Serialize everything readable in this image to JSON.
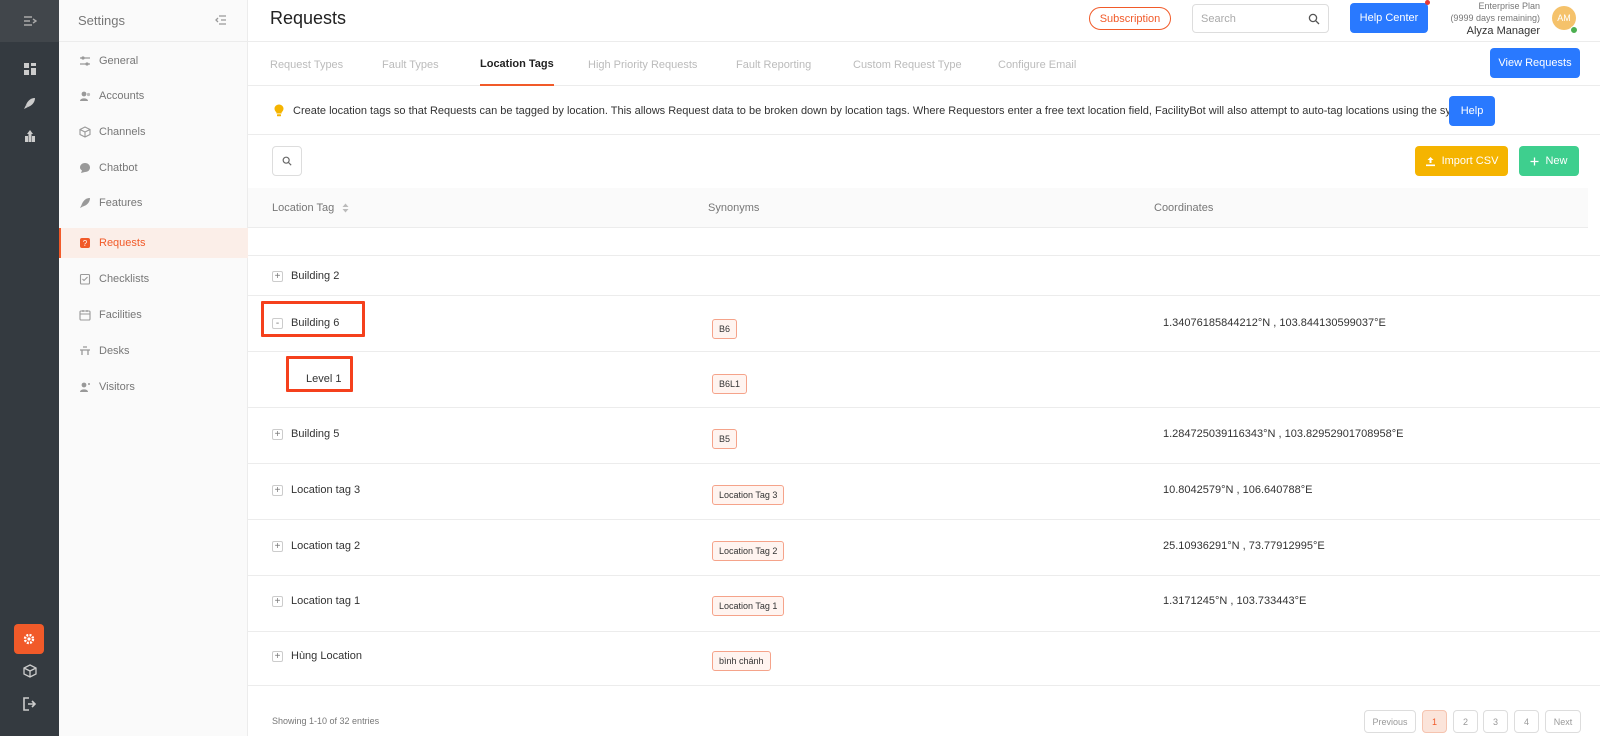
{
  "sidebar": {
    "title": "Settings",
    "items": [
      {
        "label": "General",
        "icon": "sliders-icon"
      },
      {
        "label": "Accounts",
        "icon": "users-icon"
      },
      {
        "label": "Channels",
        "icon": "cube-icon"
      },
      {
        "label": "Chatbot",
        "icon": "chat-icon"
      },
      {
        "label": "Features",
        "icon": "rocket-icon"
      },
      {
        "label": "Requests",
        "icon": "request-icon"
      },
      {
        "label": "Checklists",
        "icon": "checklist-icon"
      },
      {
        "label": "Facilities",
        "icon": "calendar-icon"
      },
      {
        "label": "Desks",
        "icon": "desk-icon"
      },
      {
        "label": "Visitors",
        "icon": "visitor-icon"
      }
    ],
    "active_item": "Requests"
  },
  "header": {
    "title": "Requests",
    "subscription_label": "Subscription",
    "search_placeholder": "Search",
    "help_center_label": "Help Center",
    "plan_name": "Enterprise Plan",
    "plan_remaining": "(9999 days remaining)",
    "user_name": "Alyza Manager",
    "avatar_initials": "AM"
  },
  "tabs": {
    "items": [
      "Request Types",
      "Fault Types",
      "Location Tags",
      "High Priority Requests",
      "Fault Reporting",
      "Custom Request Type",
      "Configure Email"
    ],
    "active": "Location Tags",
    "view_requests_label": "View Requests"
  },
  "info": {
    "text": "Create location tags so that Requests can be tagged by location. This allows Request data to be broken down by location tags. Where Requestors enter a free text location field, FacilityBot will also attempt to auto-tag locations using the synonyms.",
    "help_label": "Help"
  },
  "toolbar": {
    "import_label": "Import CSV",
    "new_label": "New"
  },
  "table": {
    "columns": [
      "Location Tag",
      "Synonyms",
      "Coordinates"
    ],
    "rows": [
      {
        "name": "Building 2",
        "expander": "+",
        "synonym": "",
        "coordinates": ""
      },
      {
        "name": "Building 6",
        "expander": "-",
        "synonym": "B6",
        "coordinates": "1.34076185844212°N , 103.844130599037°E"
      },
      {
        "name": "Level 1",
        "expander": "",
        "synonym": "B6L1",
        "coordinates": ""
      },
      {
        "name": "Building 5",
        "expander": "+",
        "synonym": "B5",
        "coordinates": "1.284725039116343°N , 103.82952901708958°E"
      },
      {
        "name": "Location tag 3",
        "expander": "+",
        "synonym": "Location Tag 3",
        "coordinates": "10.8042579°N , 106.640788°E"
      },
      {
        "name": "Location tag 2",
        "expander": "+",
        "synonym": "Location Tag 2",
        "coordinates": "25.10936291°N , 73.77912995°E"
      },
      {
        "name": "Location tag 1",
        "expander": "+",
        "synonym": "Location Tag 1",
        "coordinates": "1.3171245°N , 103.733443°E"
      },
      {
        "name": "Hùng Location",
        "expander": "+",
        "synonym": "bình chánh",
        "coordinates": ""
      }
    ]
  },
  "footer": {
    "showing_text": "Showing 1-10 of 32 entries",
    "previous_label": "Previous",
    "pages": [
      "1",
      "2",
      "3",
      "4"
    ],
    "active_page": "1",
    "next_label": "Next"
  },
  "colors": {
    "accent": "#f15a29",
    "primary_button": "#2979ff",
    "import_button": "#f5b400",
    "new_button": "#3ecf8e",
    "rail": "#343a40",
    "highlight_box": "#f5401c"
  }
}
